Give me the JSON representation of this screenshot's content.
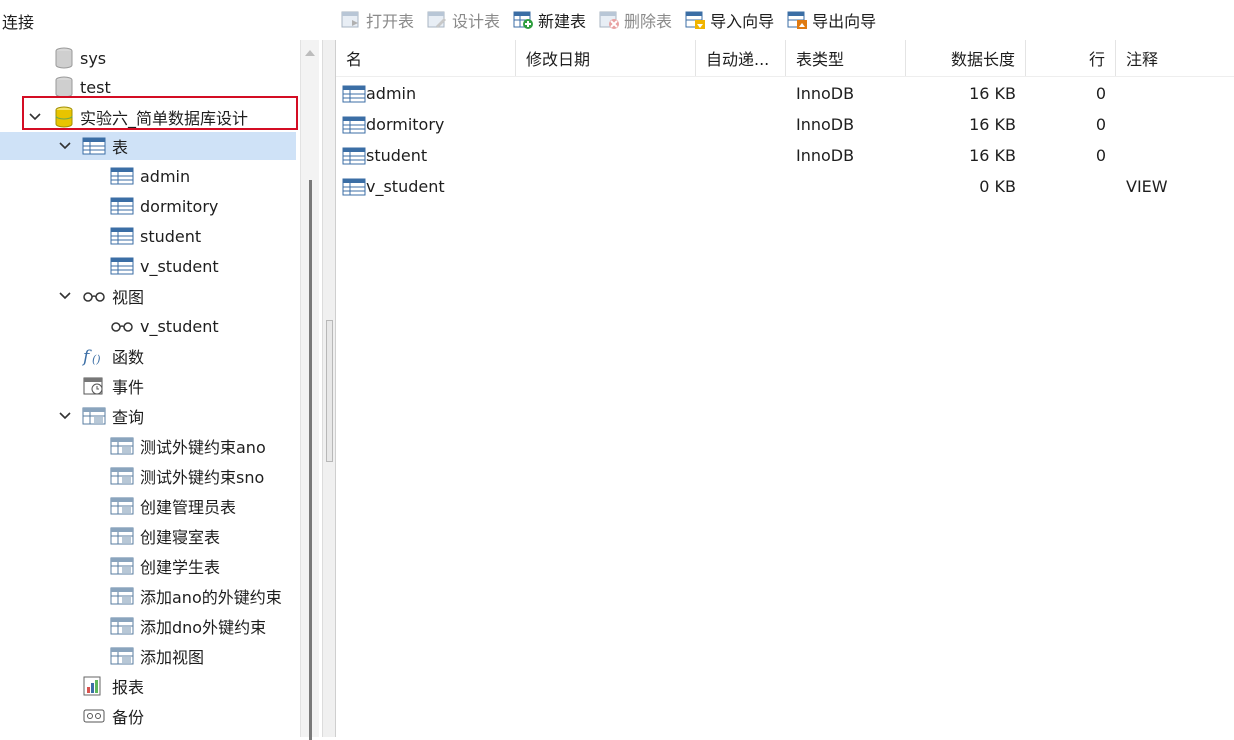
{
  "header": {
    "connection_label": "连接"
  },
  "toolbar": {
    "open_table": "打开表",
    "design_table": "设计表",
    "new_table": "新建表",
    "delete_table": "删除表",
    "import_wizard": "导入向导",
    "export_wizard": "导出向导"
  },
  "tree": {
    "db_sys": "sys",
    "db_test": "test",
    "db_current": "实验六_简单数据库设计",
    "tables_group": "表",
    "tables": [
      "admin",
      "dormitory",
      "student",
      "v_student"
    ],
    "views_group": "视图",
    "views": [
      "v_student"
    ],
    "functions_group": "函数",
    "events_group": "事件",
    "queries_group": "查询",
    "queries": [
      "测试外键约束ano",
      "测试外键约束sno",
      "创建管理员表",
      "创建寝室表",
      "创建学生表",
      "添加ano的外键约束",
      "添加dno外键约束",
      "添加视图"
    ],
    "reports_group": "报表",
    "backup_group": "备份"
  },
  "grid": {
    "columns": {
      "name": "名",
      "modified": "修改日期",
      "auto_inc": "自动递...",
      "type": "表类型",
      "data_length": "数据长度",
      "rows": "行",
      "comment": "注释"
    },
    "rows": [
      {
        "name": "admin",
        "type": "InnoDB",
        "data_length": "16 KB",
        "rows": "0",
        "comment": ""
      },
      {
        "name": "dormitory",
        "type": "InnoDB",
        "data_length": "16 KB",
        "rows": "0",
        "comment": ""
      },
      {
        "name": "student",
        "type": "InnoDB",
        "data_length": "16 KB",
        "rows": "0",
        "comment": ""
      },
      {
        "name": "v_student",
        "type": "",
        "data_length": "0 KB",
        "rows": "",
        "comment": "VIEW"
      }
    ]
  },
  "colors": {
    "selection": "#cfe2f7",
    "highlight_border": "#d40d24",
    "db_icon": "#e8c400"
  }
}
